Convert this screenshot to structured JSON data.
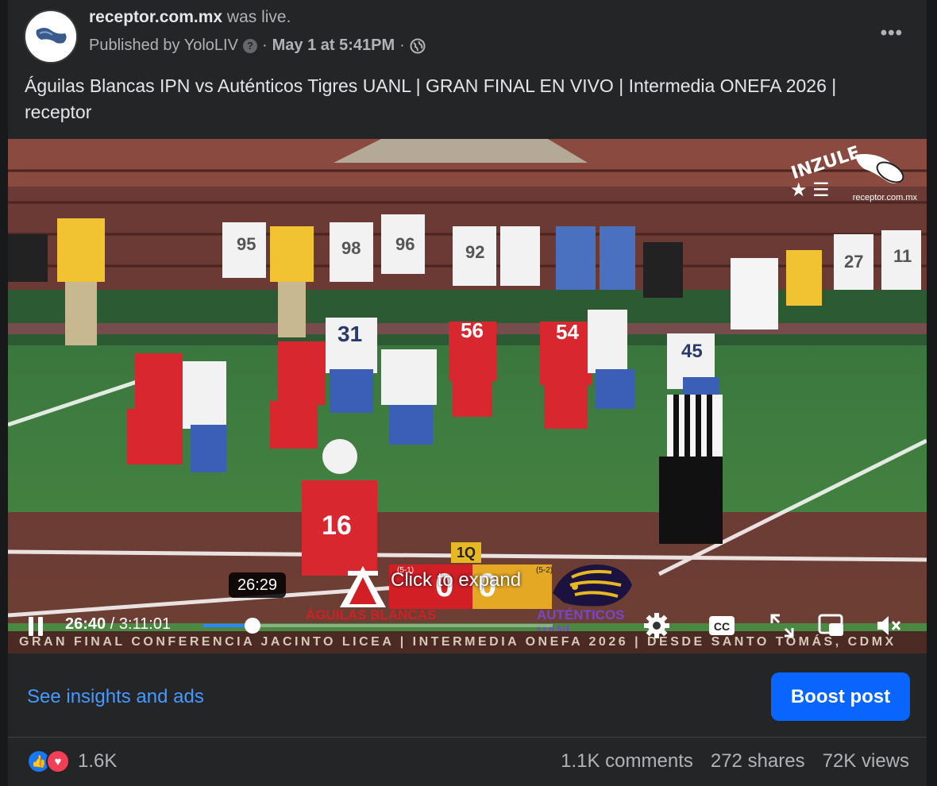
{
  "post": {
    "page_name": "receptor.com.mx",
    "live_suffix": "was live.",
    "published_by": "Published by YoloLIV",
    "separator": "·",
    "date": "May 1 at 5:41PM",
    "more_label": "•••",
    "caption": "Águilas Blancas IPN vs Auténticos Tigres UANL | GRAN FINAL EN VIVO | Intermedia ONEFA 2026 | receptor",
    "avatar_text": "receptor.com.mx"
  },
  "video": {
    "overlay_brand": "INZULE",
    "overlay_site": "receptor.com.mx",
    "quarter": "1Q",
    "team_a": "ÁGUILAS BLANCAS",
    "team_b": "AUTÉNTICOS UANL",
    "record_a": "(5-1)",
    "record_b": "(5-2)",
    "score_a": "0",
    "score_b": "0",
    "expand_text": "Click to expand",
    "hover_time": "26:29",
    "banner": "GRAN FINAL CONFERENCIA JACINTO LICEA | INTERMEDIA ONEFA 2026 | DESDE SANTO TOMÁS, CDMX",
    "current_time": "26:40",
    "time_sep": " / ",
    "duration": "3:11:01",
    "progress_fraction": 0.14,
    "accent_color": "#2d88ff"
  },
  "footer": {
    "insights_label": "See insights and ads",
    "boost_label": "Boost post",
    "reaction_count": "1.6K",
    "comments": "1.1K comments",
    "shares": "272 shares",
    "views": "72K views"
  }
}
